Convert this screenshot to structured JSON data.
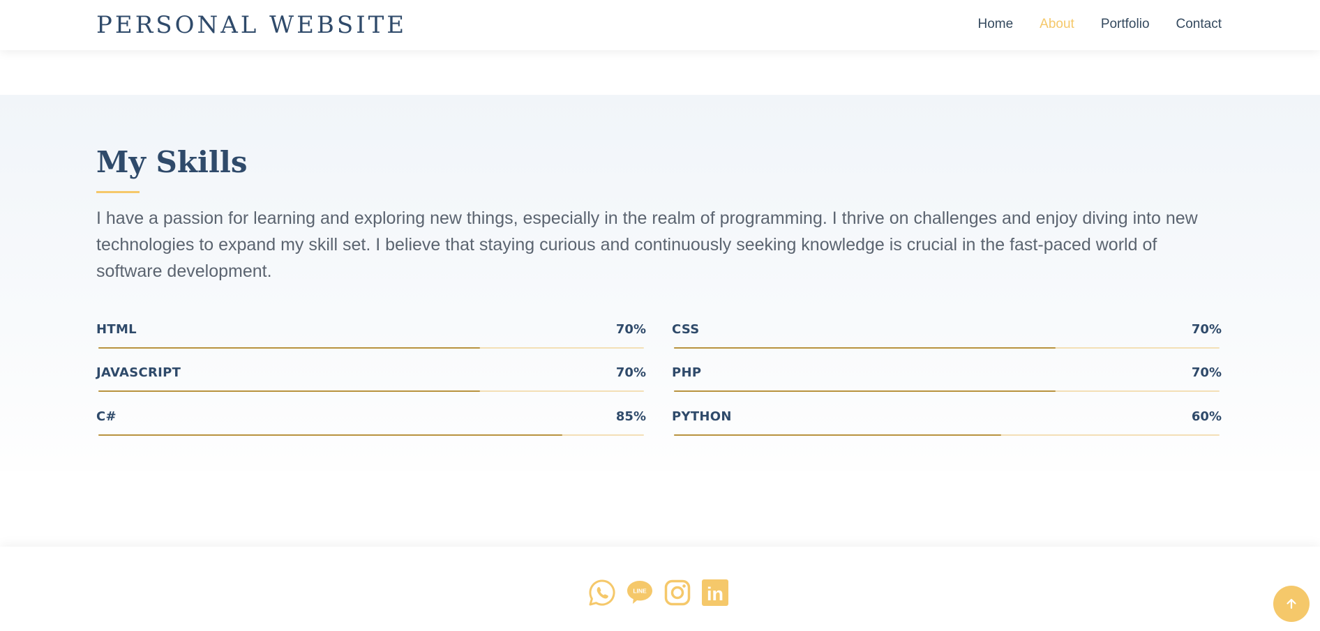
{
  "header": {
    "brand": "PERSONAL WEBSITE",
    "nav": [
      {
        "label": "Home",
        "active": false
      },
      {
        "label": "About",
        "active": true
      },
      {
        "label": "Portfolio",
        "active": false
      },
      {
        "label": "Contact",
        "active": false
      }
    ]
  },
  "skills_section": {
    "title": "My Skills",
    "intro": "I have a passion for learning and exploring new things, especially in the realm of programming. I thrive on challenges and enjoy diving into new technologies to expand my skill set. I believe that staying curious and continuously seeking knowledge is crucial in the fast-paced world of software development.",
    "skills": [
      {
        "name": "HTML",
        "percent_label": "70%",
        "level": 0.7
      },
      {
        "name": "CSS",
        "percent_label": "70%",
        "level": 0.7
      },
      {
        "name": "JAVASCRIPT",
        "percent_label": "70%",
        "level": 0.7
      },
      {
        "name": "PHP",
        "percent_label": "70%",
        "level": 0.7
      },
      {
        "name": "C#",
        "percent_label": "85%",
        "level": 0.85
      },
      {
        "name": "PYTHON",
        "percent_label": "60%",
        "level": 0.6
      }
    ]
  },
  "footer": {
    "socials": [
      {
        "icon": "whatsapp-icon"
      },
      {
        "icon": "line-icon",
        "text": "LINE"
      },
      {
        "icon": "instagram-icon"
      },
      {
        "icon": "linkedin-icon",
        "text": "in"
      }
    ]
  },
  "back_to_top": {
    "icon": "arrow-up-icon"
  },
  "colors": {
    "accent": "#f5c86a",
    "heading": "#2f4a6a",
    "bar_fill": "#b8923e",
    "bar_track": "#f3dfb6"
  }
}
